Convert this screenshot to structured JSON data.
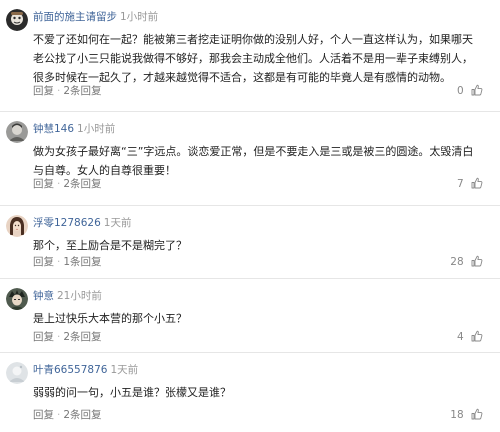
{
  "comments": [
    {
      "username": "前面的施主请留步",
      "time": "1小时前",
      "body": "不爱了还如何在一起？能被第三者挖走证明你做的没别人好，个人一直这样认为，如果哪天老公找了小三只能说我做得不够好，那我会主动成全他们。人活着不是用一辈子束缚别人，很多时候在一起久了，才越来越觉得不适合，这都是有可能的毕竟人是有感情的动物。",
      "reply_label": "回复",
      "replies": "2条回复",
      "likes": "0",
      "avatar_icon": "avatar-cartoon-icon"
    },
    {
      "username": "钟慧146",
      "time": "1小时前",
      "body": "做为女孩子最好离“三”字远点。谈恋爱正常，但是不要走入是三或是被三的圆途。太毁清白与自尊。女人的自尊很重要！",
      "reply_label": "回复",
      "replies": "2条回复",
      "likes": "7",
      "avatar_icon": "avatar-photo-icon"
    },
    {
      "username": "浮零1278626",
      "time": "1天前",
      "body": "那个，至上励合是不是糊完了？",
      "reply_label": "回复",
      "replies": "1条回复",
      "likes": "28",
      "avatar_icon": "avatar-portrait-icon"
    },
    {
      "username": "钟意",
      "time": "21小时前",
      "body": "是上过快乐大本营的那个小五？",
      "reply_label": "回复",
      "replies": "2条回复",
      "likes": "4",
      "avatar_icon": "avatar-anime-icon"
    },
    {
      "username": "叶青66557876",
      "time": "1天前",
      "body": "弱弱的问一句，小五是谁？张檬又是谁？",
      "reply_label": "回复",
      "replies": "2条回复",
      "likes": "18",
      "avatar_icon": "avatar-light-icon"
    }
  ],
  "colors": {
    "username": "#406599",
    "timestamp": "#999999",
    "action": "#777777",
    "divider": "#e6e6e6"
  }
}
